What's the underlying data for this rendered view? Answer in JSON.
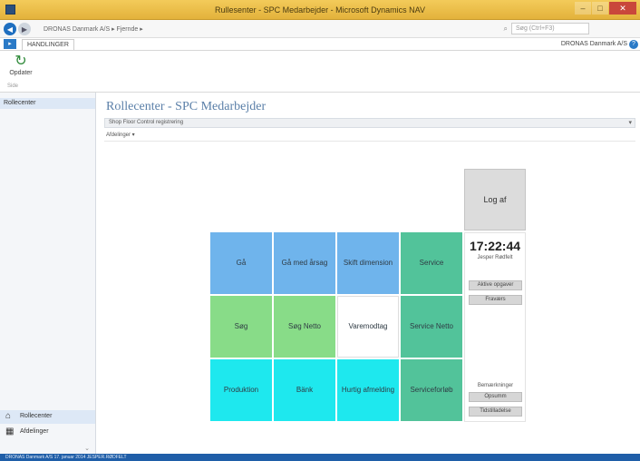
{
  "window": {
    "title": "Rullesenter - SPC Medarbejder - Microsoft Dynamics NAV",
    "controls": [
      "–",
      "□",
      "✕"
    ]
  },
  "address": {
    "path": "DRONAS Danmark A/S ▸ Fjernde ▸",
    "search_placeholder": "Søg (Ctrl+F3)"
  },
  "tabrow": {
    "home_label": "▸",
    "tab_label": "HANDLINGER",
    "company": "DRONAS Danmark A/S",
    "help": "?"
  },
  "ribbon": {
    "refresh_label": "Opdater",
    "group_label": "Side"
  },
  "sidebar": {
    "item_selected": "Rollecenter",
    "bottom": [
      {
        "label": "Rollecenter",
        "icon": "⌂"
      },
      {
        "label": "Afdelinger",
        "icon": "▦"
      }
    ],
    "collapse": "⌄"
  },
  "main": {
    "title": "Rollecenter - SPC Medarbejder",
    "filter_label": "Shop Floor Control registrering",
    "subfilter_label": "Afdelinger ▾"
  },
  "tiles": [
    {
      "label": "Gå",
      "color": "#6fb4ec"
    },
    {
      "label": "Gå med årsag",
      "color": "#6fb4ec"
    },
    {
      "label": "Skift dimension",
      "color": "#6fb4ec"
    },
    {
      "label": "Service",
      "color": "#52c39a"
    },
    {
      "label": "Søg",
      "color": "#88dc88"
    },
    {
      "label": "Søg Netto",
      "color": "#88dc88"
    },
    {
      "label": "Varemodtag",
      "color": "#ffffff"
    },
    {
      "label": "Service Netto",
      "color": "#52c39a"
    },
    {
      "label": "Produktion",
      "color": "#1ee8ee"
    },
    {
      "label": "Bänk",
      "color": "#1ee8ee"
    },
    {
      "label": "Hurtig afmelding",
      "color": "#1ee8ee"
    },
    {
      "label": "Serviceforløb",
      "color": "#52c39a"
    }
  ],
  "panel": {
    "logoff_label": "Log af",
    "clock": "17:22:44",
    "user": "Jesper Rødfelt",
    "btn_1": "Aktive opgaver",
    "btn_2": "Fraværs",
    "notes_label": "Bemærkninger",
    "btn_3": "Opsumm",
    "btn_4": "Tidstilladelse"
  },
  "statusbar": {
    "text": "DRONAS Danmark A/S    17. januar 2014    JESPER.RØDFELT"
  }
}
